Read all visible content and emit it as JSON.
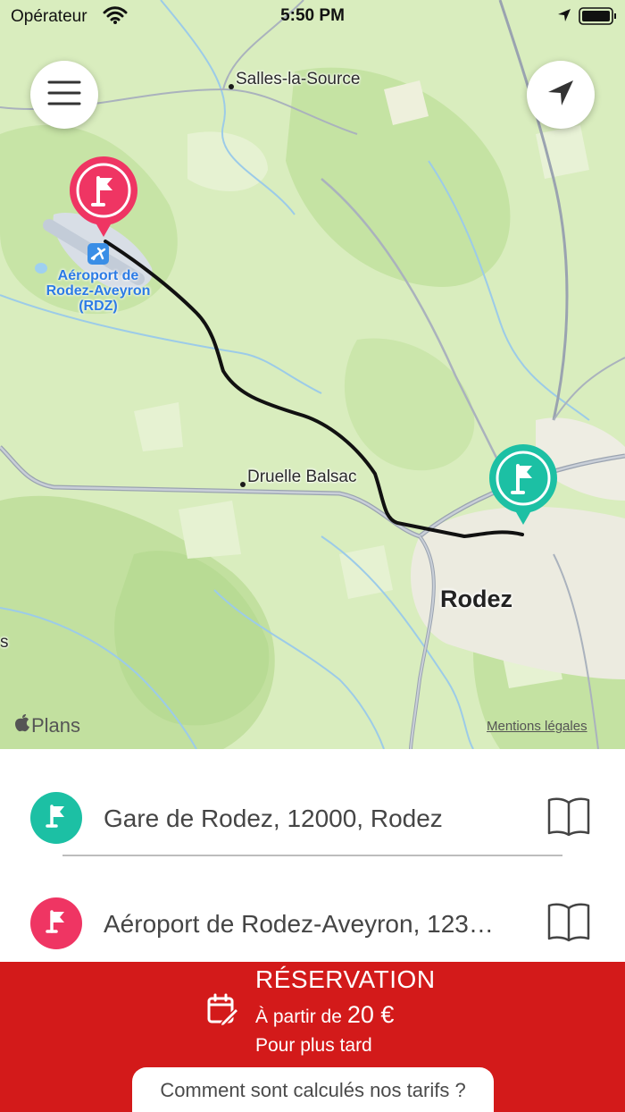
{
  "status_bar": {
    "carrier": "Opérateur",
    "time": "5:50 PM"
  },
  "map": {
    "places": {
      "salles": "Salles-la-Source",
      "druelle": "Druelle Balsac",
      "rodez": "Rodez",
      "edge_letter": "s"
    },
    "airport": {
      "line1": "Aéroport de",
      "line2": "Rodez-Aveyron",
      "line3": "(RDZ)"
    },
    "attribution": "Plans",
    "legal": "Mentions légales",
    "route_color": "#111111",
    "start_marker_color": "#1cc0a4",
    "end_marker_color": "#ef3563"
  },
  "controls": {
    "menu_icon": "hamburger-icon",
    "locate_icon": "navigation-arrow-icon"
  },
  "addresses": {
    "departure": "Gare de Rodez, 12000, Rodez",
    "arrival": "Aéroport de Rodez-Aveyron, 123…",
    "departure_color": "#1cc0a4",
    "arrival_color": "#ef3563"
  },
  "reservation": {
    "title": "RÉSERVATION",
    "price_prefix": "À partir de",
    "price": "20 €",
    "later": "Pour plus tard",
    "tarif_link": "Comment sont calculés nos tarifs ?",
    "background": "#d31a1a"
  }
}
